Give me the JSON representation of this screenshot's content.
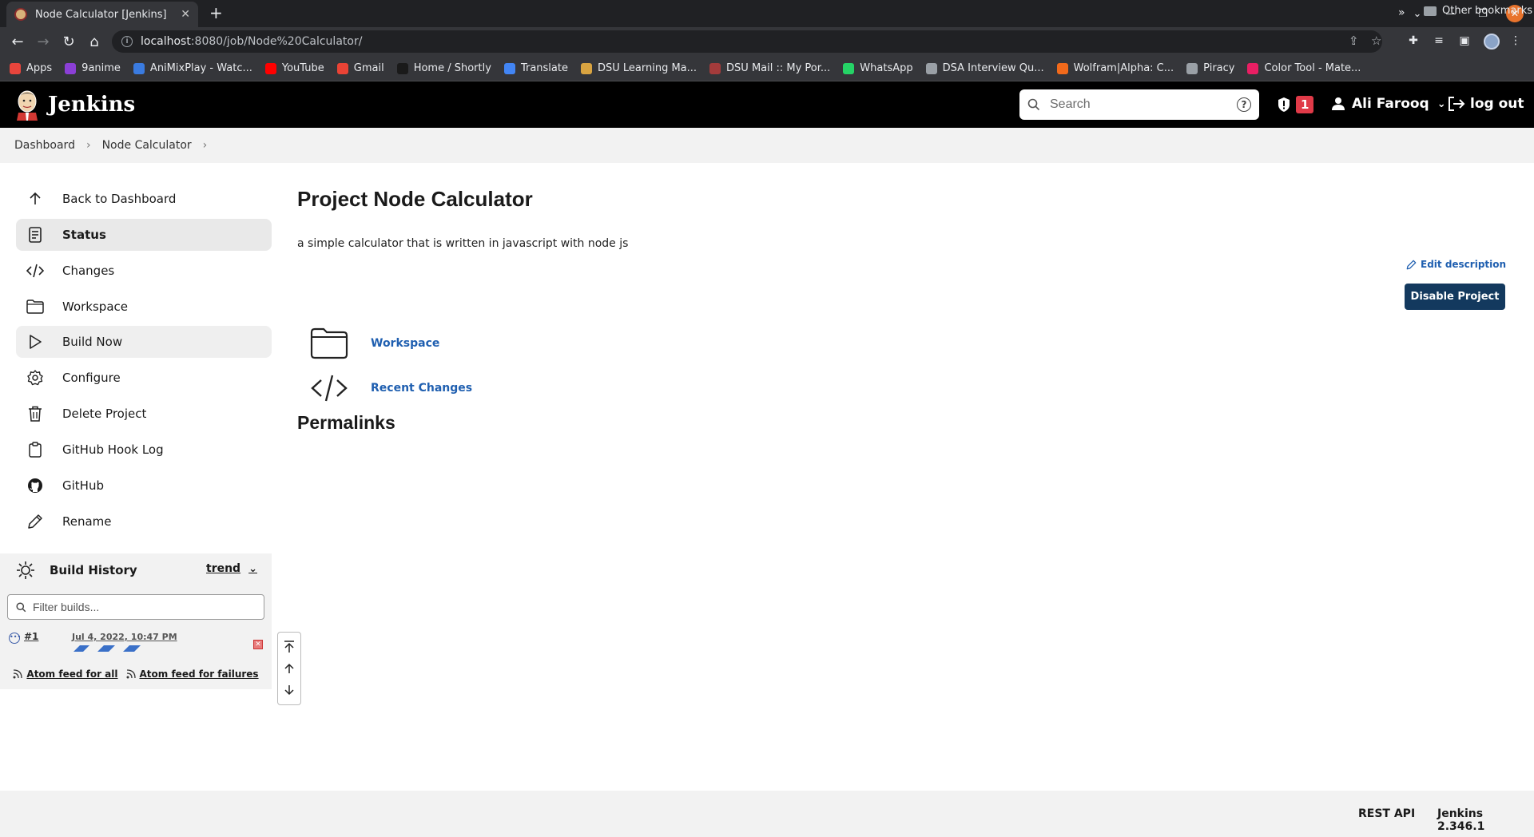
{
  "browser": {
    "tab_title": "Node Calculator [Jenkins]",
    "url_host": "localhost",
    "url_rest": ":8080/job/Node%20Calculator/",
    "bookmarks": [
      {
        "label": "Apps",
        "color": "#e8453c"
      },
      {
        "label": "9anime",
        "color": "#8b3fd6"
      },
      {
        "label": "AniMixPlay - Watc...",
        "color": "#3a7be0"
      },
      {
        "label": "YouTube",
        "color": "#ff0000"
      },
      {
        "label": "Gmail",
        "color": "#ea4335"
      },
      {
        "label": "Home / Shortly",
        "color": "#1a1a1a"
      },
      {
        "label": "Translate",
        "color": "#4285f4"
      },
      {
        "label": "DSU Learning Ma...",
        "color": "#d9a441"
      },
      {
        "label": "DSU Mail :: My Por...",
        "color": "#a33b3b"
      },
      {
        "label": "WhatsApp",
        "color": "#25d366"
      },
      {
        "label": "DSA Interview Qu...",
        "color": "#9aa0a6"
      },
      {
        "label": "Wolfram|Alpha: C...",
        "color": "#f26a1b"
      },
      {
        "label": "Piracy",
        "color": "#9aa0a6"
      },
      {
        "label": "Color Tool - Mate...",
        "color": "#e91e63"
      }
    ],
    "other_bookmarks": "Other bookmarks"
  },
  "header": {
    "title": "Jenkins",
    "search_placeholder": "Search",
    "alert_count": "1",
    "user_name": "Ali Farooq",
    "logout_label": "log out"
  },
  "breadcrumb": {
    "items": [
      "Dashboard",
      "Node Calculator"
    ]
  },
  "sidebar": {
    "items": [
      {
        "label": "Back to Dashboard",
        "icon": "arrow-up-icon"
      },
      {
        "label": "Status",
        "icon": "document-icon"
      },
      {
        "label": "Changes",
        "icon": "code-icon"
      },
      {
        "label": "Workspace",
        "icon": "folder-icon"
      },
      {
        "label": "Build Now",
        "icon": "play-icon"
      },
      {
        "label": "Configure",
        "icon": "gear-icon"
      },
      {
        "label": "Delete Project",
        "icon": "trash-icon"
      },
      {
        "label": "GitHub Hook Log",
        "icon": "clipboard-icon"
      },
      {
        "label": "GitHub",
        "icon": "github-icon"
      },
      {
        "label": "Rename",
        "icon": "pencil-icon"
      }
    ]
  },
  "build_history": {
    "title": "Build History",
    "trend_label": "trend",
    "filter_placeholder": "Filter builds...",
    "builds": [
      {
        "number": "#1",
        "date": "Jul 4, 2022, 10:47 PM"
      }
    ],
    "feed_all": "Atom feed for all",
    "feed_failures": "Atom feed for failures"
  },
  "main": {
    "title": "Project Node Calculator",
    "description": "a simple calculator that is written in javascript with node js",
    "edit_description": "Edit description",
    "disable_button": "Disable Project",
    "links": [
      {
        "label": "Workspace",
        "icon": "folder-icon"
      },
      {
        "label": "Recent Changes",
        "icon": "code-icon"
      }
    ],
    "permalinks_heading": "Permalinks"
  },
  "footer": {
    "rest_api": "REST API",
    "version": "Jenkins 2.346.1"
  },
  "colors": {
    "header_bg": "#000000",
    "link": "#1f5fb0",
    "primary_button": "#13395e",
    "alert_badge": "#e03a48"
  }
}
